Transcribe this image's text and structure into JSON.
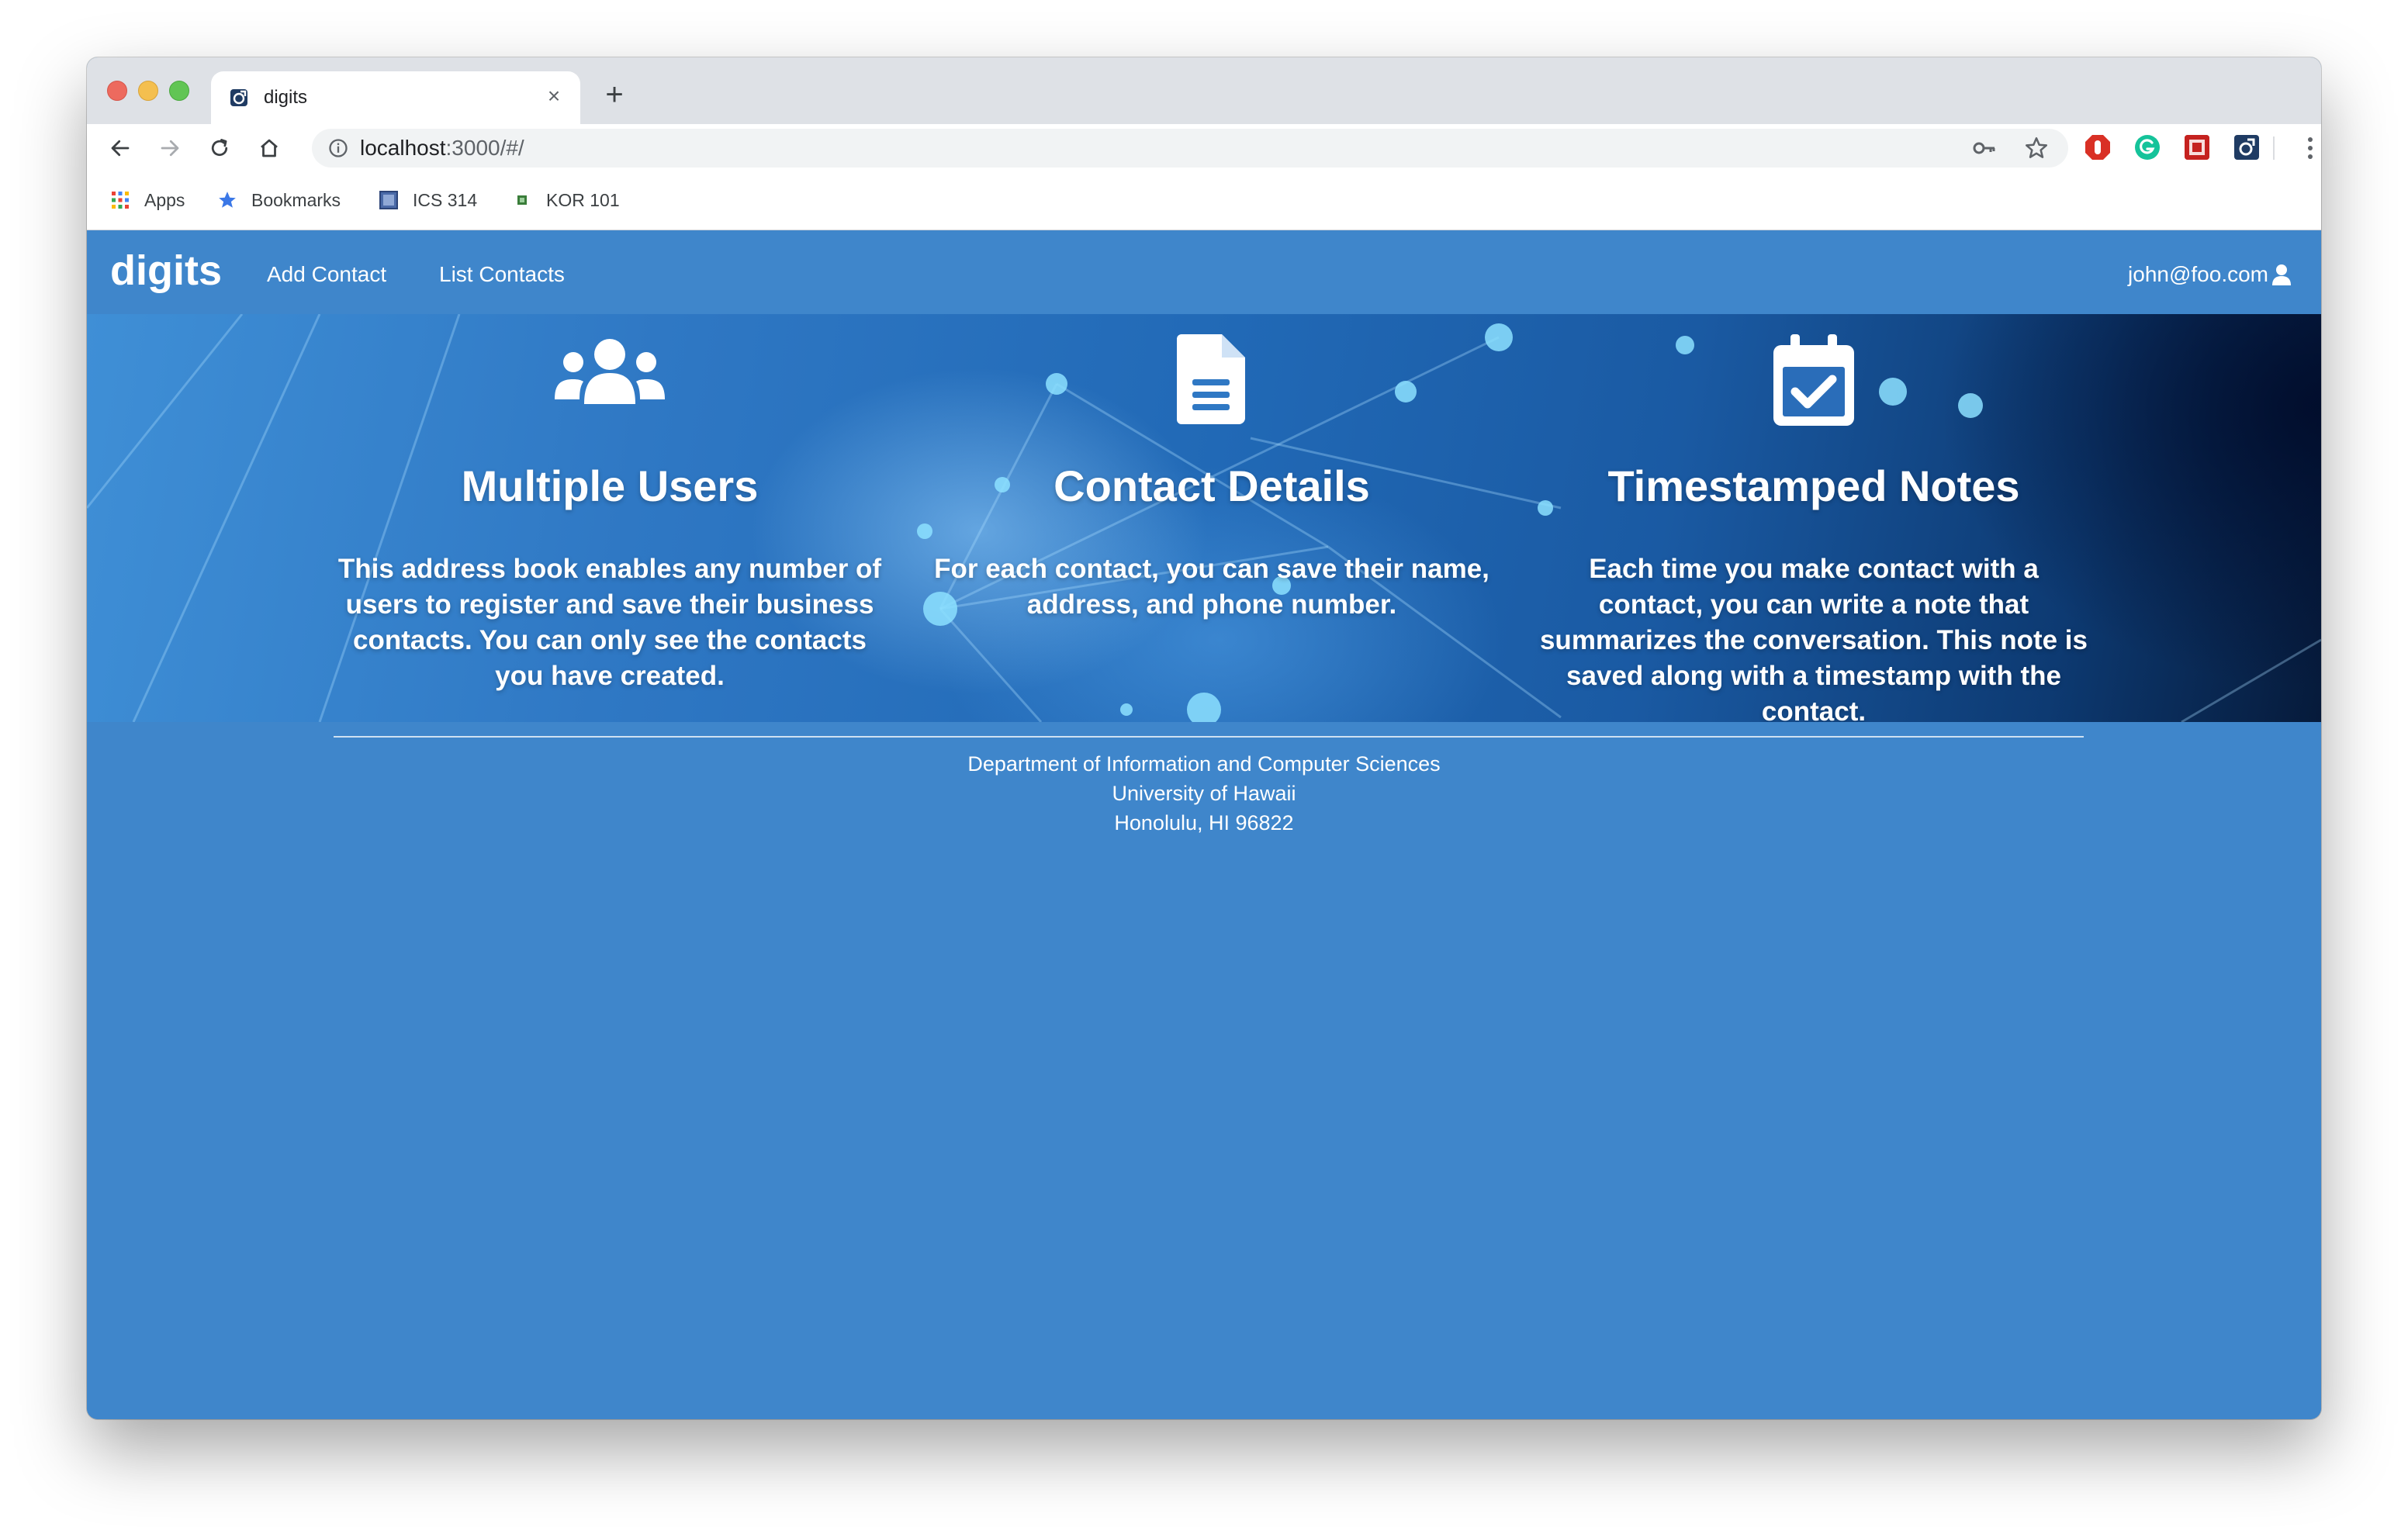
{
  "browser": {
    "tab_title": "digits",
    "new_tab_label": "+",
    "close_label": "×",
    "url_host": "localhost",
    "url_path": ":3000/#/"
  },
  "bookmarks": [
    {
      "label": "Apps",
      "icon": "apps-grid-icon"
    },
    {
      "label": "Bookmarks",
      "icon": "star-icon"
    },
    {
      "label": "ICS 314",
      "icon": "folder-icon"
    },
    {
      "label": "KOR 101",
      "icon": "bookmark-icon"
    }
  ],
  "app": {
    "brand": "digits",
    "nav": {
      "add_contact": "Add Contact",
      "list_contacts": "List Contacts"
    },
    "user": "john@foo.com"
  },
  "features": [
    {
      "icon": "users-icon",
      "title": "Multiple Users",
      "text": "This address book enables any number of users to register and save their business contacts. You can only see the contacts you have created."
    },
    {
      "icon": "document-icon",
      "title": "Contact Details",
      "text": "For each contact, you can save their name, address, and phone number."
    },
    {
      "icon": "calendar-check-icon",
      "title": "Timestamped Notes",
      "text": "Each time you make contact with a contact, you can write a note that summarizes the conversation. This note is saved along with a timestamp with the contact."
    }
  ],
  "footer": {
    "line1": "Department of Information and Computer Sciences",
    "line2": "University of Hawaii",
    "line3": "Honolulu, HI 96822"
  },
  "colors": {
    "page_blue": "#3f86cb",
    "tab_strip": "#dee1e6",
    "omnibox": "#f1f3f4"
  }
}
